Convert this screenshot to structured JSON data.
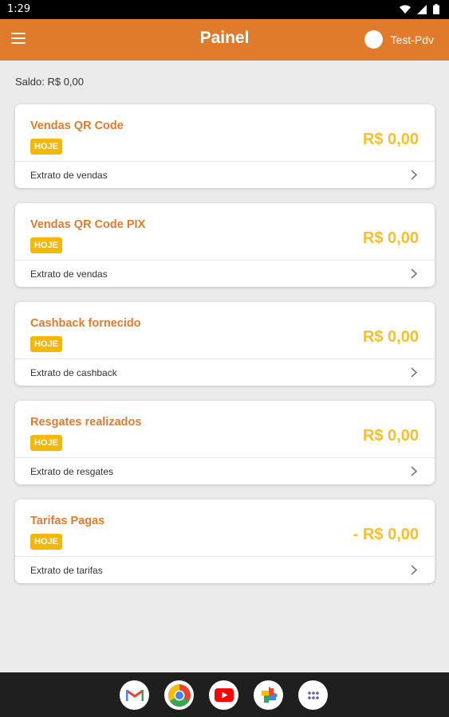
{
  "status_bar": {
    "time": "1:29"
  },
  "app_bar": {
    "title": "Painel",
    "user_name": "Test-Pdv"
  },
  "saldo": "Saldo: R$ 0,00",
  "cards": [
    {
      "title": "Vendas QR Code",
      "badge": "HOJE",
      "amount": "R$ 0,00",
      "footer": "Extrato de vendas"
    },
    {
      "title": "Vendas QR Code PIX",
      "badge": "HOJE",
      "amount": "R$ 0,00",
      "footer": "Extrato de vendas"
    },
    {
      "title": "Cashback fornecido",
      "badge": "HOJE",
      "amount": "R$ 0,00",
      "footer": "Extrato de cashback"
    },
    {
      "title": "Resgates realizados",
      "badge": "HOJE",
      "amount": "R$ 0,00",
      "footer": "Extrato de resgates"
    },
    {
      "title": "Tarifas Pagas",
      "badge": "HOJE",
      "amount": "- R$ 0,00",
      "footer": "Extrato de tarifas"
    }
  ],
  "dock_apps": [
    "gmail-icon",
    "chrome-icon",
    "youtube-icon",
    "photos-icon",
    "app-drawer-icon"
  ],
  "colors": {
    "primary": "#e07b2c",
    "accent": "#f5c02a",
    "badge": "#f5b800"
  }
}
